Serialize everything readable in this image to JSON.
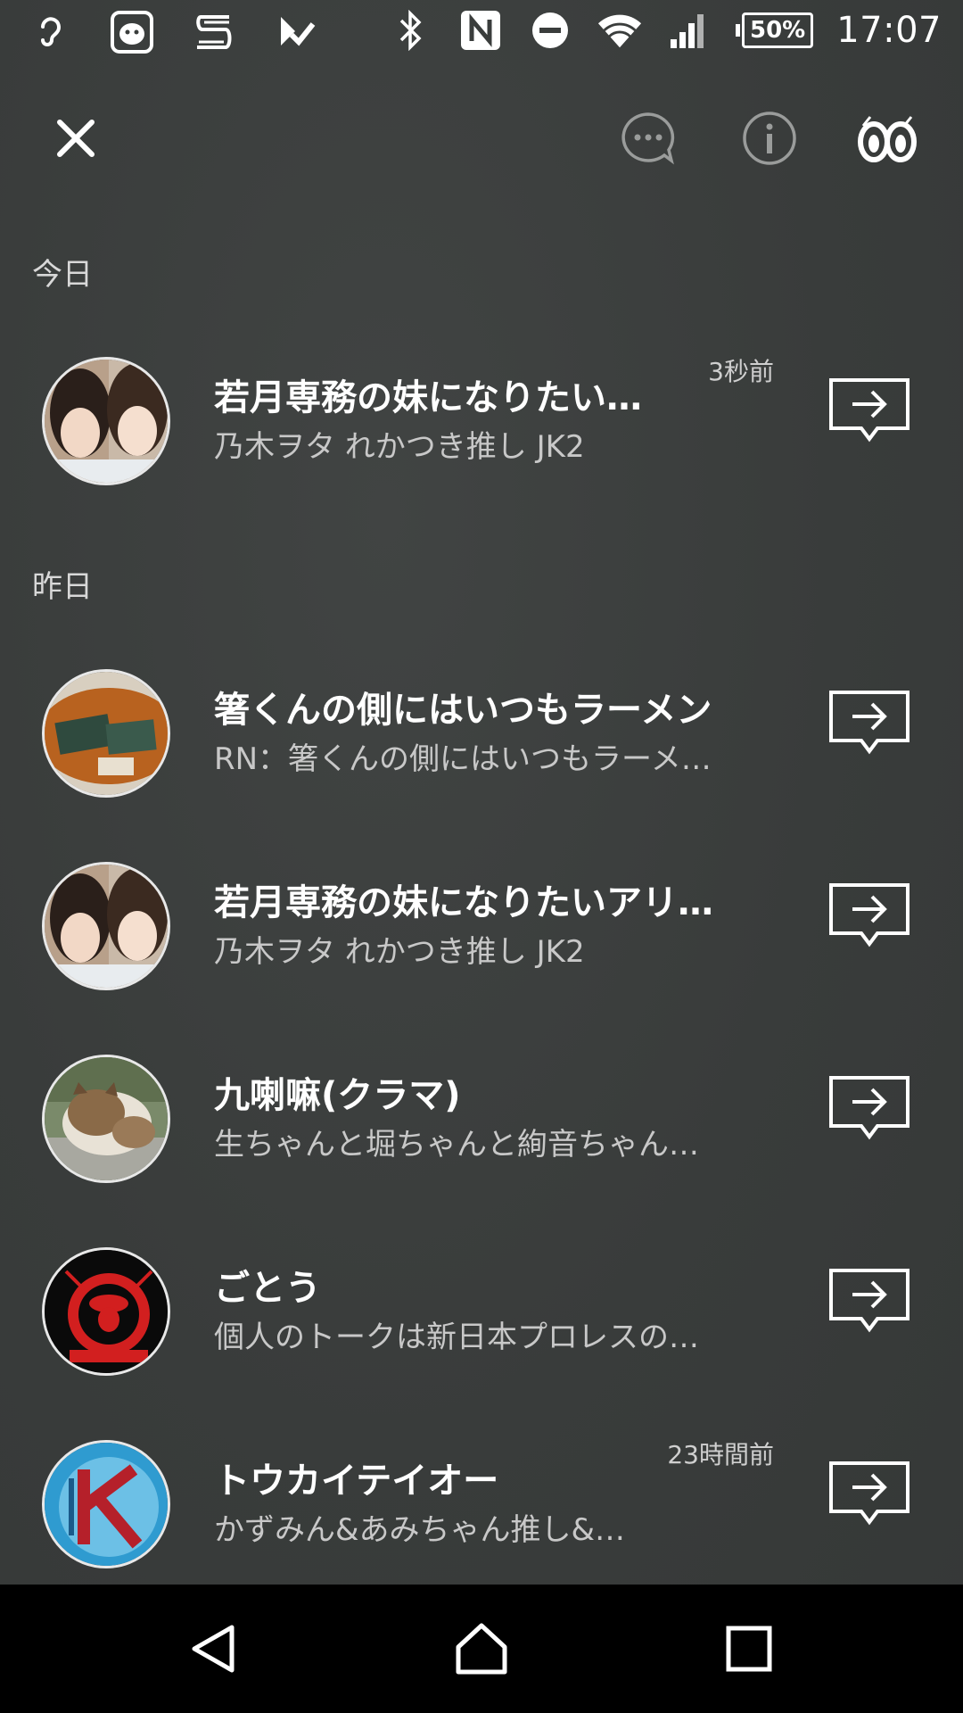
{
  "status_bar": {
    "time": "17:07",
    "battery": "50%",
    "left_icons": [
      "hearing-icon",
      "line-app-icon",
      "s-app-icon",
      "check-app-icon"
    ],
    "right_icons": [
      "bluetooth-icon",
      "nfc-icon",
      "dnd-icon",
      "wifi-icon",
      "signal-icon"
    ]
  },
  "toolbar": {
    "close_icon": "close-icon",
    "chat_icon": "chat-bubble-icon",
    "info_icon": "info-icon",
    "eyes_icon": "eyes-icon"
  },
  "sections": {
    "today": "今日",
    "yesterday": "昨日"
  },
  "items": [
    {
      "title": "若月専務の妹になりたい…",
      "subtitle": "乃木ヲタ れかつき推し JK2",
      "time": "3秒前",
      "avatar": "two-girls-photo"
    },
    {
      "title": "箸くんの側にはいつもラーメン",
      "subtitle": "RN：箸くんの側にはいつもラーメ…",
      "time": "",
      "avatar": "cards-photo"
    },
    {
      "title": "若月専務の妹になりたいアリ…",
      "subtitle": "乃木ヲタ れかつき推し JK2",
      "time": "",
      "avatar": "two-girls-photo"
    },
    {
      "title": "九喇嘛(クラマ)",
      "subtitle": "生ちゃんと堀ちゃんと絢音ちゃん…",
      "time": "",
      "avatar": "cat-photo"
    },
    {
      "title": "ごとう",
      "subtitle": "個人のトークは新日本プロレスの…",
      "time": "",
      "avatar": "tranquilo-logo"
    },
    {
      "title": "トウカイテイオー",
      "subtitle": "かずみん&あみちゃん推し&…",
      "time": "23時間前",
      "avatar": "k-logo"
    }
  ],
  "nav_bar": {
    "back_icon": "back-icon",
    "home_icon": "home-icon",
    "recents_icon": "recents-icon"
  },
  "colors": {
    "background": "#3a3d3c",
    "text_primary": "#ffffff",
    "text_secondary": "#c8c8c8",
    "nav_bg": "#000000"
  }
}
